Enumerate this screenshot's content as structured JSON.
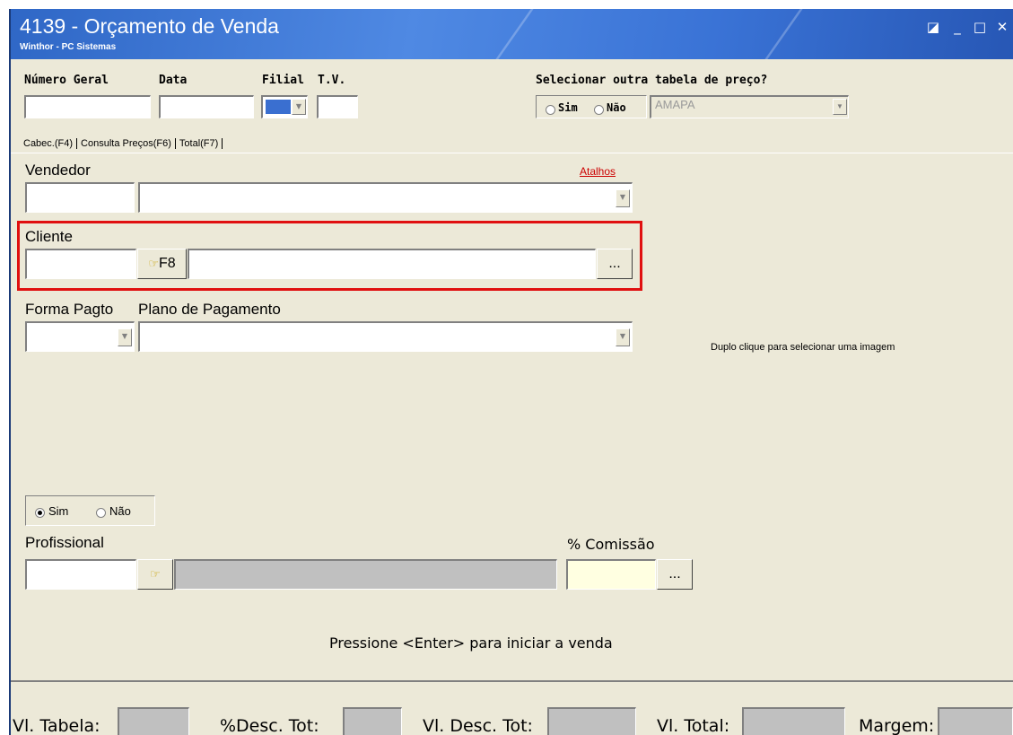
{
  "window": {
    "title": "4139 - Orçamento de Venda",
    "subtitle": "Winthor - PC Sistemas",
    "controls": {
      "restore": "◪",
      "minimize": "_",
      "maximize": "□",
      "close": "✕"
    }
  },
  "header": {
    "numero_geral_label": "Número Geral",
    "data_label": "Data",
    "filial_label": "Filial",
    "tv_label": "T.V.",
    "price_table_question": "Selecionar outra tabela de preço?",
    "radio_sim": "Sim",
    "radio_nao": "Não",
    "price_table_value": "AMAPA"
  },
  "tabs": [
    "Cabec.(F4)",
    "Consulta Preços(F6)",
    "Total(F7)"
  ],
  "form": {
    "vendedor_label": "Vendedor",
    "atalhos_link": "Atalhos",
    "cliente_label": "Cliente",
    "f8_label": "F8",
    "ellipsis": "...",
    "forma_pagto_label": "Forma Pagto",
    "plano_pagamento_label": "Plano de Pagamento",
    "image_hint": "Duplo clique para selecionar uma imagem",
    "sim_label": "Sim",
    "nao_label": "Não",
    "profissional_label": "Profissional",
    "comissao_label": "% Comissão",
    "enter_hint": "Pressione <Enter> para iniciar a venda"
  },
  "statusbar": {
    "vl_tabela": "Vl. Tabela:",
    "desc_tot_pct": "%Desc. Tot:",
    "vl_desc_tot": "Vl. Desc. Tot:",
    "vl_total": "Vl. Total:",
    "margem": "Margem:"
  },
  "colors": {
    "titlebar": "#3a73d6",
    "highlight_box": "#e01010",
    "link": "#cc0000",
    "filial_swatch": "#3a6fd0"
  }
}
